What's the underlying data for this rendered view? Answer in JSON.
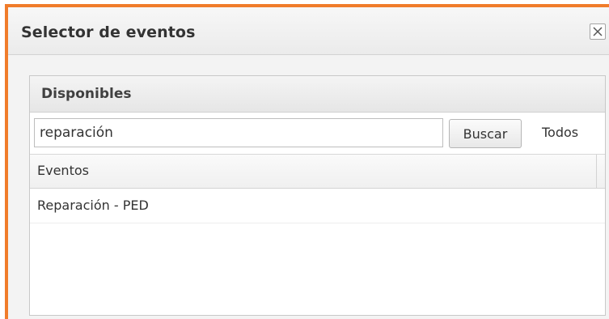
{
  "dialog": {
    "title": "Selector de eventos",
    "close_icon": "close-icon"
  },
  "panel": {
    "title": "Disponibles",
    "search": {
      "value": "reparación",
      "button_label": "Buscar",
      "all_label": "Todos"
    },
    "table": {
      "column_header": "Eventos",
      "rows": [
        {
          "label": "Reparación - PED"
        }
      ]
    }
  },
  "colors": {
    "accent_border": "#f07c2b"
  }
}
